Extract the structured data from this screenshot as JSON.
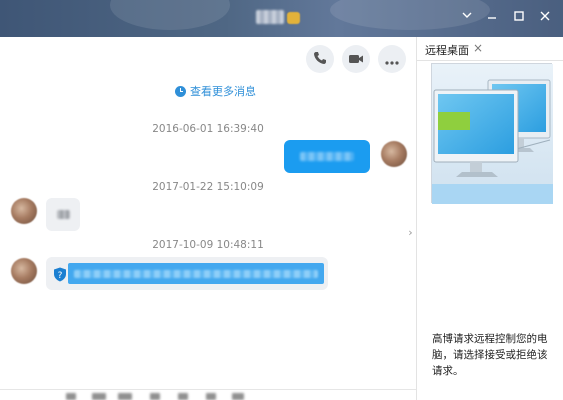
{
  "window": {
    "icons": {
      "minimize": "minimize-icon",
      "maximize": "maximize-icon",
      "close": "close-icon"
    }
  },
  "chat": {
    "actions": {
      "call": "phone-icon",
      "video": "video-camera-icon",
      "more": "more-icon"
    },
    "view_more_label": "查看更多消息",
    "messages": [
      {
        "timestamp": "2016-06-01 16:39:40",
        "side": "outgoing"
      },
      {
        "timestamp": "2017-01-22 15:10:09",
        "side": "incoming"
      },
      {
        "timestamp": "2017-10-09 10:48:11",
        "side": "incoming",
        "icon": "shield-question-icon"
      }
    ]
  },
  "panel": {
    "tab_label": "远程桌面",
    "tab_close": "×",
    "message": "高博请求远程控制您的电脑，请选择接受或拒绝该请求。"
  },
  "colors": {
    "accent_blue": "#1b9cf0",
    "link_blue": "#2f8fd8",
    "titlebar": "#4f6784"
  }
}
